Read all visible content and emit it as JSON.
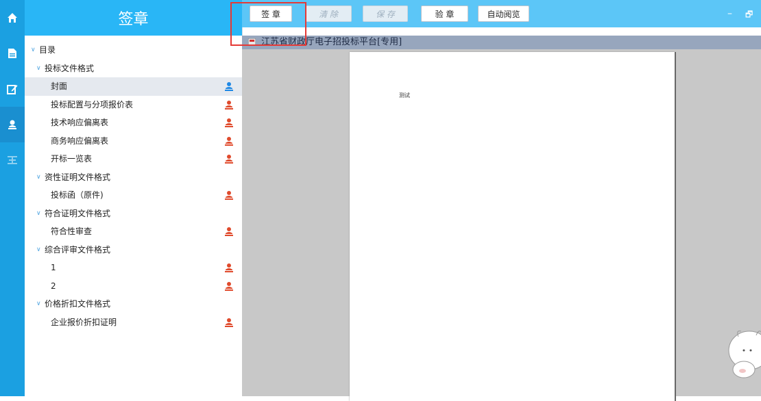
{
  "sidebar": {
    "title": "签章",
    "tree": [
      {
        "label": "目录",
        "level": 0,
        "expandable": true
      },
      {
        "label": "投标文件格式",
        "level": 1,
        "expandable": true
      },
      {
        "label": "封面",
        "level": 2,
        "stamp": "blue",
        "selected": true
      },
      {
        "label": "投标配置与分项报价表",
        "level": 2,
        "stamp": "red"
      },
      {
        "label": "技术响应偏离表",
        "level": 2,
        "stamp": "red"
      },
      {
        "label": "商务响应偏离表",
        "level": 2,
        "stamp": "red"
      },
      {
        "label": "开标一览表",
        "level": 2,
        "stamp": "red"
      },
      {
        "label": "资性证明文件格式",
        "level": 1,
        "expandable": true
      },
      {
        "label": "投标函（原件)",
        "level": 2,
        "stamp": "red"
      },
      {
        "label": "符合证明文件格式",
        "level": 1,
        "expandable": true
      },
      {
        "label": "符合性审查",
        "level": 2,
        "stamp": "red"
      },
      {
        "label": "综合评审文件格式",
        "level": 1,
        "expandable": true
      },
      {
        "label": "1",
        "level": 2,
        "stamp": "red"
      },
      {
        "label": "2",
        "level": 2,
        "stamp": "red"
      },
      {
        "label": "价格折扣文件格式",
        "level": 1,
        "expandable": true
      },
      {
        "label": "企业报价折扣证明",
        "level": 2,
        "stamp": "red"
      }
    ]
  },
  "toolbar": {
    "sign_label": "签 章",
    "clear_label": "清 除",
    "save_label": "保 存",
    "verify_label": "验 章",
    "autoread_label": "自动阅览"
  },
  "window": {
    "minimize_glyph": "–",
    "restore_glyph": "🗗"
  },
  "document": {
    "tab_title": "江苏省财政厅电子招投标平台[专用]",
    "page_text": "测试"
  },
  "rail_icons": [
    "home-icon",
    "document-icon",
    "edit-icon",
    "user-stamp-icon",
    "tree-icon"
  ],
  "colors": {
    "accent": "#1ba0e1",
    "header": "#29b6f6",
    "toolbar": "#5cc6f7",
    "stamp_red": "#e04a2c",
    "stamp_blue": "#1e88e5",
    "highlight": "#e53935"
  }
}
